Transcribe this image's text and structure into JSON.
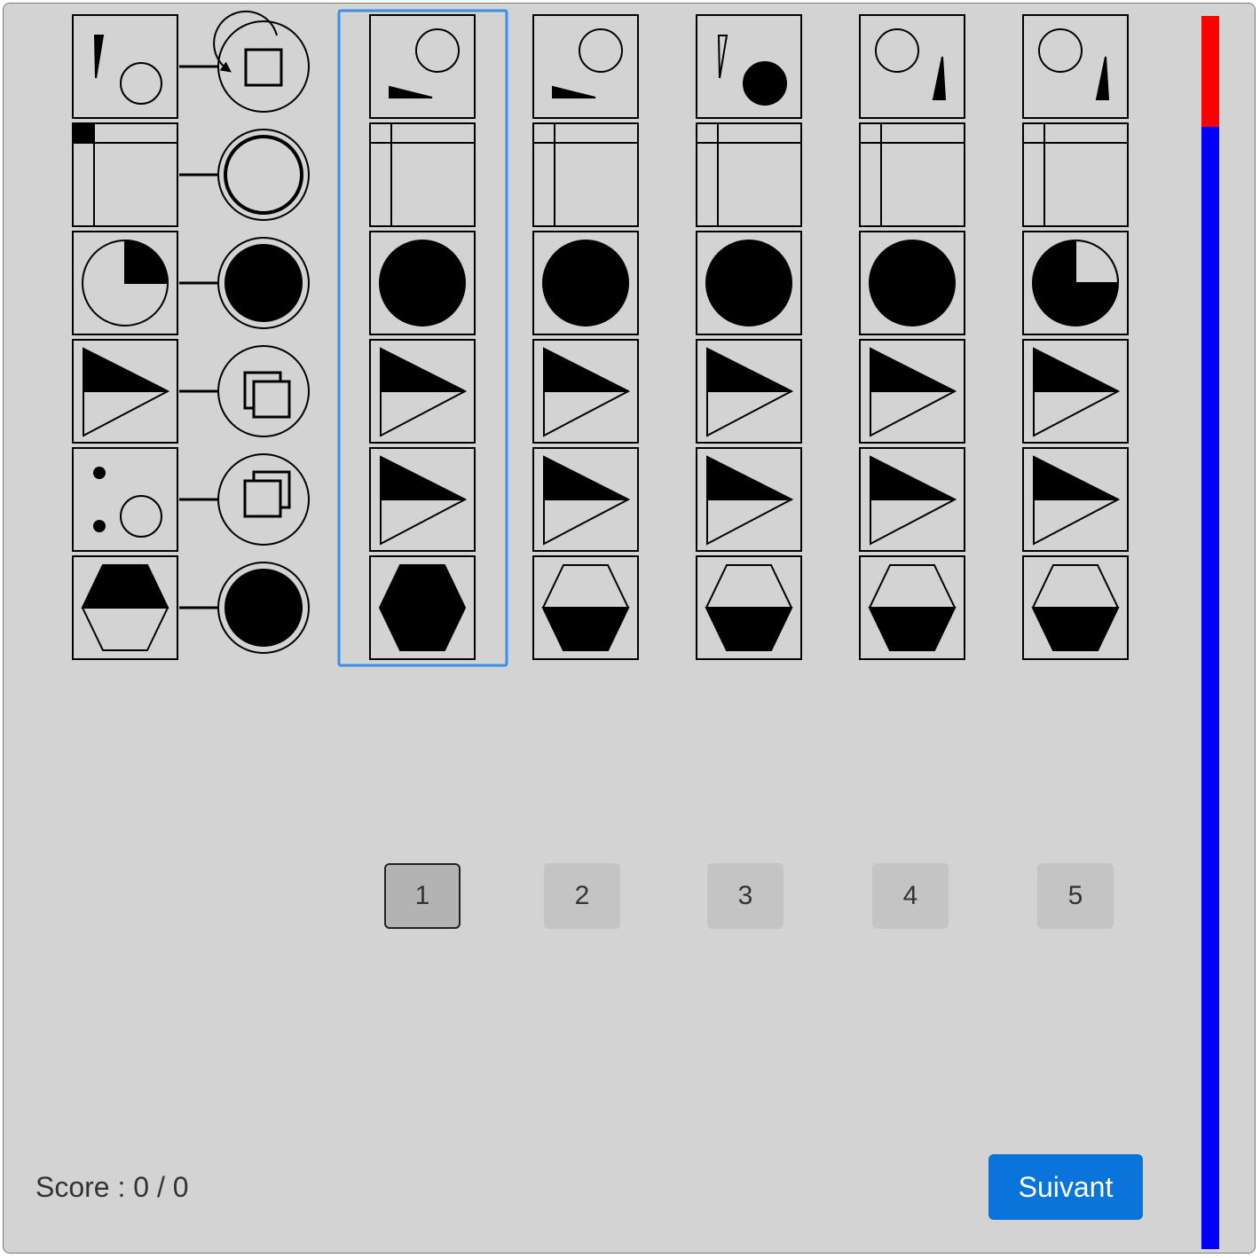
{
  "options": [
    {
      "label": "1",
      "selected": true
    },
    {
      "label": "2",
      "selected": false
    },
    {
      "label": "3",
      "selected": false
    },
    {
      "label": "4",
      "selected": false
    },
    {
      "label": "5",
      "selected": false
    }
  ],
  "score": {
    "text": "Score : 0 / 0"
  },
  "next_button": {
    "label": "Suivant"
  },
  "timer": {
    "elapsed_fraction": 0.09,
    "elapsed_color": "#ff0000",
    "remaining_color": "#0000ff"
  },
  "rule_icons": [
    "rotate-icon",
    "double-circle-icon",
    "black-circle-icon",
    "duplicate-icon",
    "duplicate-icon",
    "black-circle-icon"
  ],
  "colors": {
    "background": "#d3d3d3",
    "selection": "#3b8ee6",
    "accent": "#0a74da"
  }
}
